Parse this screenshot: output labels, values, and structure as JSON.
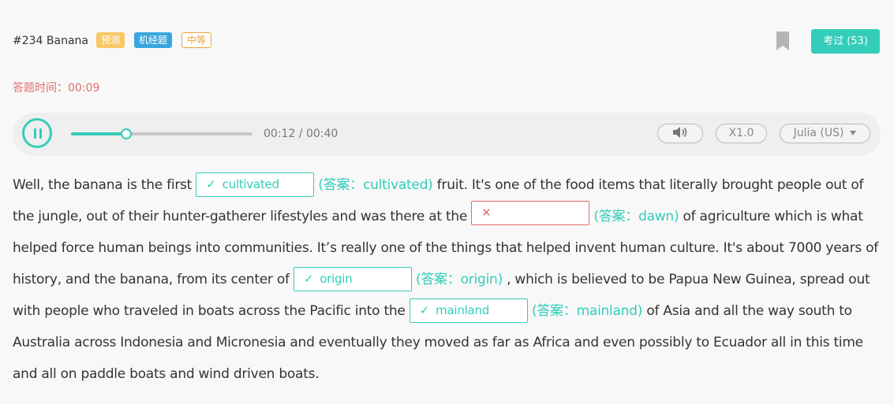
{
  "header": {
    "question_id": "#234 Banana",
    "tags": [
      "预测",
      "机经题",
      "中等"
    ],
    "exam_button": "考过 (53)"
  },
  "timer": {
    "label": "答题时间：",
    "value": "00:09"
  },
  "player": {
    "progress": 0.3,
    "time_display": "00:12 / 00:40",
    "speed": "X1.0",
    "voice": "Julia (US)"
  },
  "colors": {
    "accent": "#33cdb9",
    "error": "#e36b6b"
  },
  "icons": {
    "play": "pause-icon",
    "volume": "speaker-icon",
    "bookmark": "bookmark-icon"
  },
  "passage": {
    "p1": "Well, the banana is the first",
    "blank1": {
      "mark": "✓",
      "value": "cultivated",
      "answer": "(答案：cultivated)"
    },
    "p2": "fruit. It's one of the food items that literally brought people out of the jungle, out of their hunter-gatherer lifestyles and was there at the",
    "blank2": {
      "mark": "✕",
      "value": "",
      "answer": "(答案：dawn)"
    },
    "p3": "of agriculture which is what helped force human beings into communities. It’s really one of the things that helped invent human culture. It's about 7000 years of history, and the banana, from its center of",
    "blank3": {
      "mark": "✓",
      "value": "origin",
      "answer": "(答案：origin)"
    },
    "p4": ", which is believed to be Papua New Guinea, spread out with people who traveled in boats across the Pacific into the",
    "blank4": {
      "mark": "✓",
      "value": "mainland",
      "answer": "(答案：mainland)"
    },
    "p5": "of Asia and all the way south to Australia across Indonesia and Micronesia and eventually they moved as far as Africa and even possibly to Ecuador all in this time and all on paddle boats and wind driven boats."
  }
}
